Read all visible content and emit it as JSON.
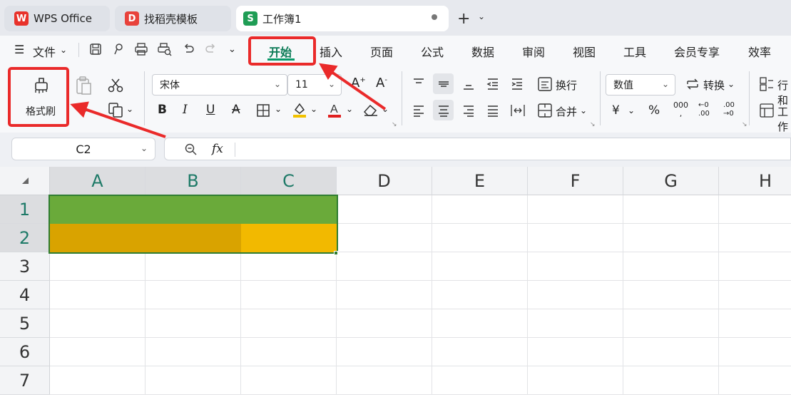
{
  "tabs": [
    {
      "label": "WPS Office",
      "logo": "W"
    },
    {
      "label": "找稻壳模板",
      "logo": "D"
    },
    {
      "label": "工作簿1",
      "logo": "S"
    }
  ],
  "menu": {
    "file": "文件",
    "items": [
      "开始",
      "插入",
      "页面",
      "公式",
      "数据",
      "审阅",
      "视图",
      "工具",
      "会员专享",
      "效率"
    ]
  },
  "ribbon": {
    "format_painter": "格式刷",
    "font_name": "宋体",
    "font_size": "11",
    "wrap": "换行",
    "merge": "合并",
    "number_format": "数值",
    "convert": "转换",
    "row_col": "行和",
    "worksheet": "工作"
  },
  "formula_bar": {
    "name_box": "C2",
    "fx": "fx",
    "content": ""
  },
  "grid": {
    "columns": [
      "A",
      "B",
      "C",
      "D",
      "E",
      "F",
      "G",
      "H"
    ],
    "rows": [
      "1",
      "2",
      "3",
      "4",
      "5",
      "6",
      "7"
    ],
    "selected_range": "A1:C2",
    "fills": {
      "row1_ABC": "#6aaa3a",
      "row2_AB": "#d9a300",
      "row2_C": "#f2b900"
    }
  },
  "colors": {
    "annotation_red": "#ea2a2a",
    "accent_green": "#1e7a68"
  }
}
